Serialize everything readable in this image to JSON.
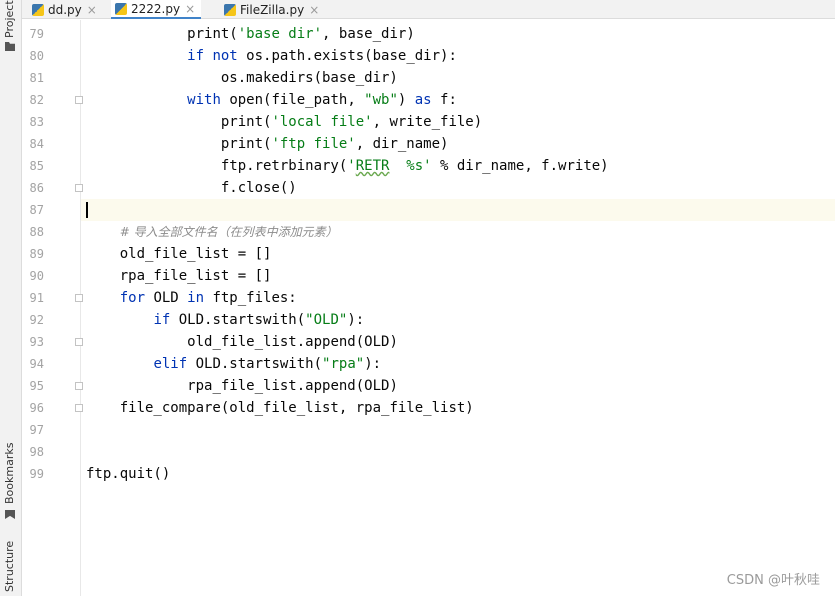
{
  "toolstrip": {
    "project_label": "Project",
    "bookmarks_label": "Bookmarks",
    "structure_label": "Structure"
  },
  "tabs": [
    {
      "label": "dd.py",
      "active": false,
      "icon": "python-file-icon"
    },
    {
      "label": "2222.py",
      "active": true,
      "icon": "python-file-icon"
    },
    {
      "label": "FileZilla.py",
      "active": false,
      "icon": "python-file-icon"
    }
  ],
  "tab_close_glyph": "×",
  "editor": {
    "current_line": 87,
    "lines": [
      {
        "n": "79",
        "indent": "            ",
        "code": [
          [
            "",
            "print("
          ],
          [
            "str",
            "'base dir'"
          ],
          [
            "",
            ", base_dir)"
          ]
        ]
      },
      {
        "n": "80",
        "indent": "            ",
        "code": [
          [
            "kw",
            "if not "
          ],
          [
            "",
            "os.path.exists(base_dir):"
          ]
        ]
      },
      {
        "n": "81",
        "indent": "                ",
        "code": [
          [
            "",
            "os.makedirs(base_dir)"
          ]
        ]
      },
      {
        "n": "82",
        "indent": "            ",
        "code": [
          [
            "kw",
            "with "
          ],
          [
            "",
            "open(file_path, "
          ],
          [
            "str",
            "\"wb\""
          ],
          [
            "",
            ") "
          ],
          [
            "kw",
            "as "
          ],
          [
            "",
            "f:"
          ]
        ]
      },
      {
        "n": "83",
        "indent": "                ",
        "code": [
          [
            "",
            "print("
          ],
          [
            "str",
            "'local file'"
          ],
          [
            "",
            ", write_file)"
          ]
        ]
      },
      {
        "n": "84",
        "indent": "                ",
        "code": [
          [
            "",
            "print("
          ],
          [
            "str",
            "'ftp file'"
          ],
          [
            "",
            ", dir_name)"
          ]
        ]
      },
      {
        "n": "85",
        "indent": "                ",
        "code": [
          [
            "",
            "ftp.retrbinary("
          ],
          [
            "str",
            "'"
          ],
          [
            "str typo",
            "RETR"
          ],
          [
            "str",
            "  %s'"
          ],
          [
            "",
            " % dir_name, f.write)"
          ]
        ]
      },
      {
        "n": "86",
        "indent": "                ",
        "code": [
          [
            "",
            "f.close()"
          ]
        ]
      },
      {
        "n": "87",
        "indent": "",
        "code": []
      },
      {
        "n": "88",
        "indent": "    ",
        "code": [
          [
            "cmt",
            "# 导入全部文件名（在列表中添加元素）"
          ]
        ]
      },
      {
        "n": "89",
        "indent": "    ",
        "code": [
          [
            "",
            "old_file_list = []"
          ]
        ]
      },
      {
        "n": "90",
        "indent": "    ",
        "code": [
          [
            "",
            "rpa_file_list = []"
          ]
        ]
      },
      {
        "n": "91",
        "indent": "    ",
        "code": [
          [
            "kw",
            "for "
          ],
          [
            "",
            "OLD "
          ],
          [
            "kw",
            "in "
          ],
          [
            "",
            "ftp_files:"
          ]
        ]
      },
      {
        "n": "92",
        "indent": "        ",
        "code": [
          [
            "kw",
            "if "
          ],
          [
            "",
            "OLD.startswith("
          ],
          [
            "str",
            "\"OLD\""
          ],
          [
            "",
            "):"
          ]
        ]
      },
      {
        "n": "93",
        "indent": "            ",
        "code": [
          [
            "",
            "old_file_list.append(OLD)"
          ]
        ]
      },
      {
        "n": "94",
        "indent": "        ",
        "code": [
          [
            "kw",
            "elif "
          ],
          [
            "",
            "OLD.startswith("
          ],
          [
            "str",
            "\"rpa\""
          ],
          [
            "",
            "):"
          ]
        ]
      },
      {
        "n": "95",
        "indent": "            ",
        "code": [
          [
            "",
            "rpa_file_list.append(OLD)"
          ]
        ]
      },
      {
        "n": "96",
        "indent": "    ",
        "code": [
          [
            "",
            "file_compare(old_file_list, rpa_file_list)"
          ]
        ]
      },
      {
        "n": "97",
        "indent": "",
        "code": []
      },
      {
        "n": "98",
        "indent": "",
        "code": []
      },
      {
        "n": "99",
        "indent": "",
        "code": [
          [
            "",
            "ftp.quit()"
          ]
        ]
      }
    ],
    "fold_markers": [
      "82",
      "86",
      "91",
      "93",
      "95",
      "96"
    ]
  },
  "watermark": "CSDN @叶秋哇"
}
